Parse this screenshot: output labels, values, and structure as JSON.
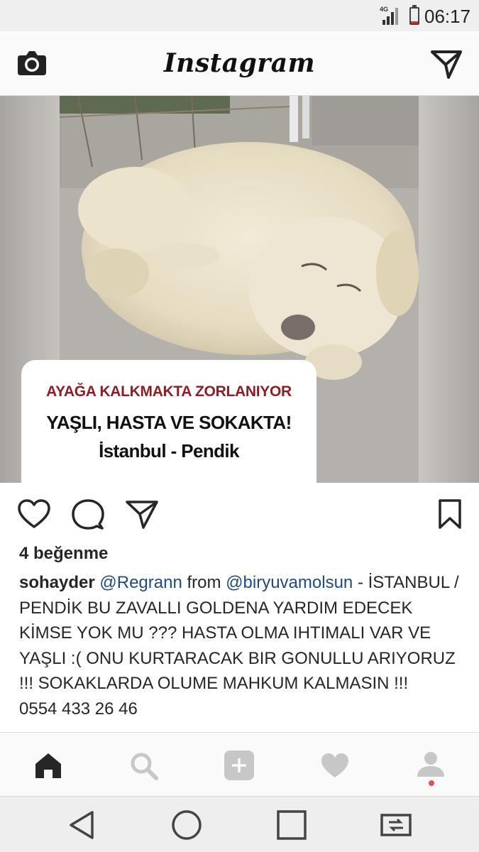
{
  "status_bar": {
    "network": "4G",
    "time": "06:17",
    "battery_color": "#e0301e"
  },
  "header": {
    "logo_text": "Instagram",
    "left_icon": "camera-icon",
    "right_icon": "direct-message-icon"
  },
  "post": {
    "image_text": {
      "line1": "AYAĞA KALKMAKTA ZORLANIYOR",
      "line2": "YAŞLI, HASTA VE SOKAKTA!",
      "line3": "İstanbul - Pendik"
    },
    "actions": [
      "heart-icon",
      "comment-icon",
      "share-icon",
      "bookmark-icon"
    ],
    "likes": "4 beğenme",
    "caption": {
      "username": "sohayder",
      "mention1": "@Regrann",
      "from_text": " from ",
      "mention2": "@biryuvamolsun",
      "text": " - İSTANBUL / PENDİK BU ZAVALLI GOLDENA YARDIM EDECEK KİMSE YOK MU ??? HASTA OLMA IHTIMALI VAR VE YAŞLI :( ONU KURTARACAK BIR GONULLU ARIYORUZ !!! SOKAKLARDA OLUME MAHKUM KALMASIN !!!",
      "phone": "0554 433 26 46"
    }
  },
  "tab_bar": {
    "tabs": [
      "home-icon",
      "search-icon",
      "add-post-icon",
      "activity-heart-icon",
      "profile-icon"
    ],
    "active": "home-icon",
    "notification_color": "#ed4956"
  },
  "nav_bar": {
    "buttons": [
      "back-icon",
      "home-circle-icon",
      "recents-icon",
      "screen-cast-icon"
    ]
  }
}
